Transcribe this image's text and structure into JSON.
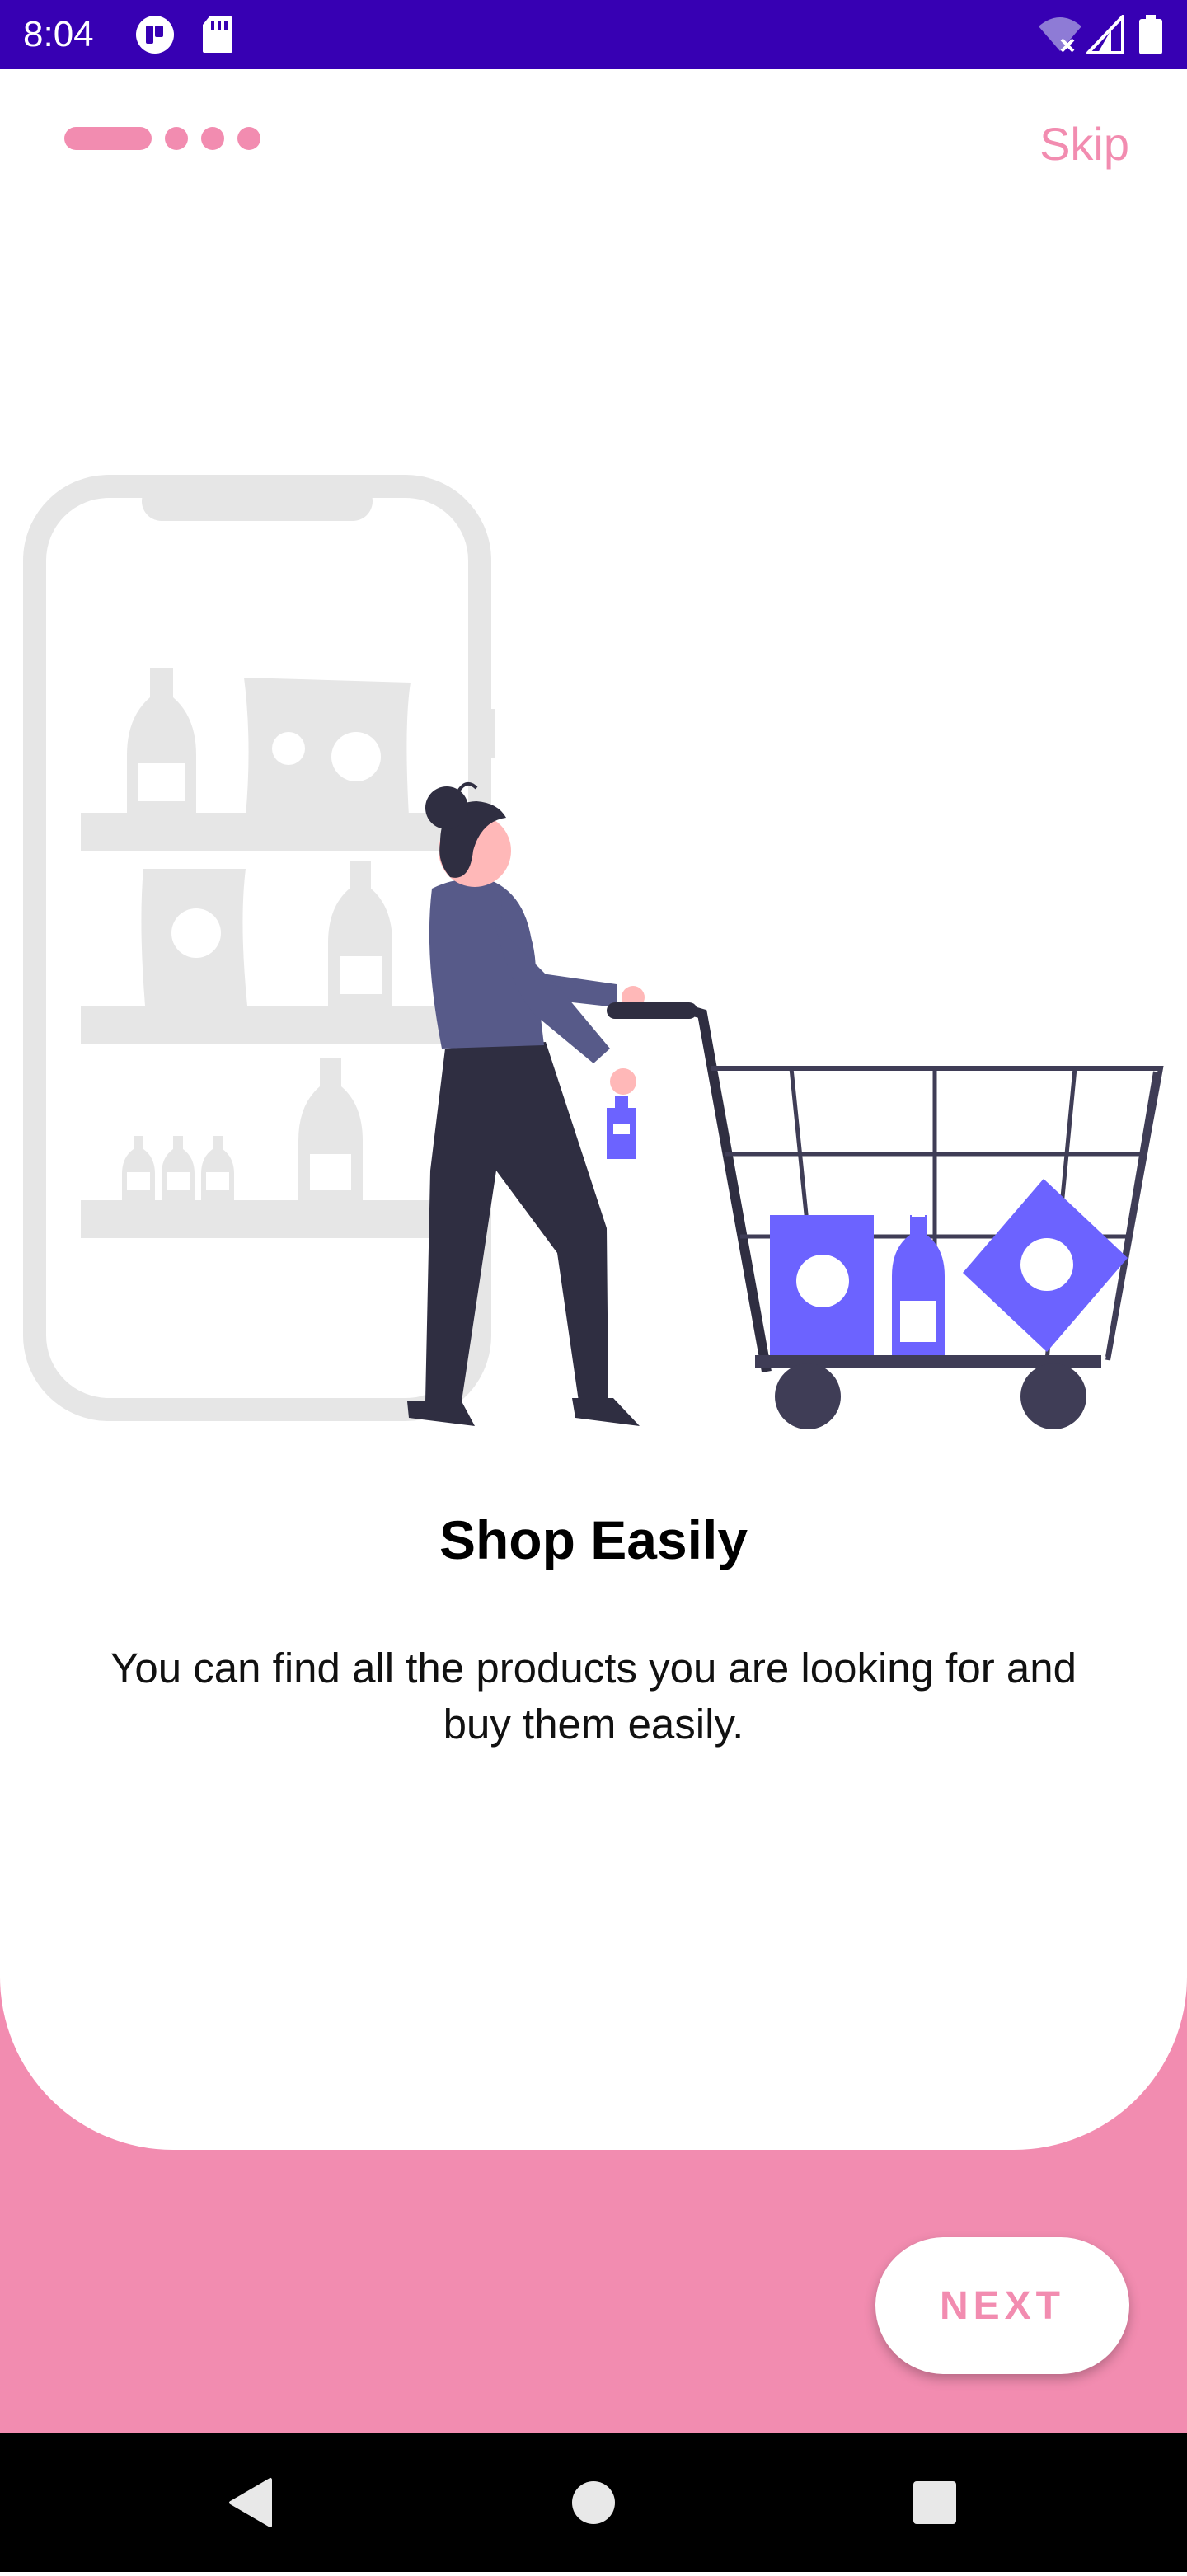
{
  "status_bar": {
    "time": "8:04",
    "icons": [
      "app-notification-icon",
      "sd-card-icon",
      "wifi-off-icon",
      "cell-signal-icon",
      "battery-icon"
    ],
    "background_color": "#3700b3"
  },
  "onboarding": {
    "pager": {
      "total_pages": 4,
      "current_page": 1
    },
    "skip_label": "Skip",
    "illustration_icon": "shopping-cart-illustration",
    "title": "Shop Easily",
    "description": "You can find all the products you are looking for and buy them easily.",
    "next_label": "NEXT"
  },
  "colors": {
    "accent": "#f28cb0",
    "illustration_purple": "#6c63ff",
    "illustration_dark": "#2f2e41",
    "illustration_gray": "#e6e6e6"
  },
  "nav_bar": {
    "buttons": [
      "back-icon",
      "home-icon",
      "recents-icon"
    ]
  }
}
